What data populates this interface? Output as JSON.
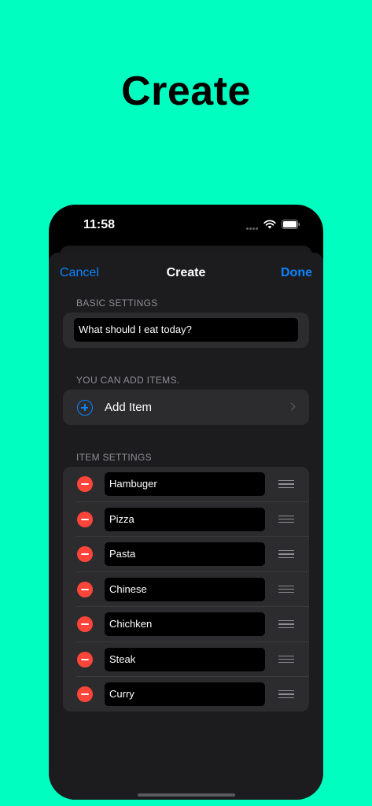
{
  "headline": "Create",
  "status": {
    "time": "11:58"
  },
  "nav": {
    "cancel": "Cancel",
    "title": "Create",
    "done": "Done"
  },
  "basic": {
    "header": "BASIC SETTINGS",
    "title_value": "What should I eat today?"
  },
  "add": {
    "header": "YOU CAN ADD ITEMS.",
    "label": "Add Item"
  },
  "items": {
    "header": "ITEM SETTINGS",
    "list": [
      "Hambuger",
      "Pizza",
      "Pasta",
      "Chinese",
      "Chichken",
      "Steak",
      "Curry"
    ]
  },
  "colors": {
    "background": "#00FEC0",
    "accent": "#0A84FF",
    "delete": "#FF453A",
    "sheet": "#1C1C1E",
    "cell": "#2C2C2E"
  },
  "icons": {
    "add": "plus-circle-icon",
    "delete": "minus-circle-icon",
    "reorder": "drag-handle-icon",
    "disclosure": "chevron-right-icon"
  }
}
